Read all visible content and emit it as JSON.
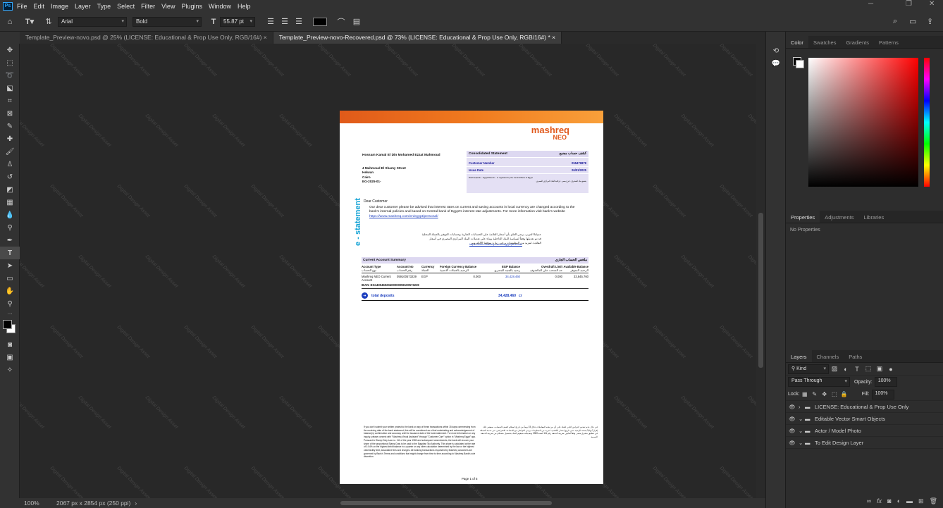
{
  "menubar": {
    "items": [
      "File",
      "Edit",
      "Image",
      "Layer",
      "Type",
      "Select",
      "Filter",
      "View",
      "Plugins",
      "Window",
      "Help"
    ]
  },
  "options": {
    "font_family": "Arial",
    "font_style": "Bold",
    "font_size": "55.87 pt",
    "color": "#000000"
  },
  "tabs": [
    {
      "label": "Template_Preview-novo.psd @ 25% (LICENSE: Educational & Prop Use Only, RGB/16#)",
      "close": "×"
    },
    {
      "label": "Template_Preview-novo-Recovered.psd @ 73% (LICENSE: Educational & Prop Use Only, RGB/16#) *",
      "close": "×"
    }
  ],
  "status": {
    "zoom": "100%",
    "dims": "2067 px x 2854 px (250 ppi)",
    "arrow": "›"
  },
  "color_panel": {
    "tabs": [
      "Color",
      "Swatches",
      "Gradients",
      "Patterns"
    ]
  },
  "properties_panel": {
    "tabs": [
      "Properties",
      "Adjustments",
      "Libraries"
    ],
    "empty": "No Properties"
  },
  "layers_panel": {
    "tabs": [
      "Layers",
      "Channels",
      "Paths"
    ],
    "kind": "Kind",
    "blend": "Pass Through",
    "opacity_label": "Opacity:",
    "opacity": "100%",
    "lock_label": "Lock:",
    "fill_label": "Fill:",
    "fill": "100%",
    "layers": [
      "LICENSE: Educational & Prop Use Only",
      "Editable Vector Smart Objects",
      "Actor / Model Photo",
      "To Edit Design Layer"
    ]
  },
  "watermark": "Digital Design Asset",
  "doc": {
    "logo_line1": "mashreq",
    "logo_line2": "NEO",
    "vertical_text": "e - statement",
    "customer_name": "Hossam Kamal El Din Mohamed Ezzat Mahmoud",
    "address": [
      "4 Mahmoud El Shamy Street",
      "Helwan",
      "Cairo",
      "EG-2025-01-"
    ],
    "box_title": "Consolidated Statement",
    "box_title_ar": "كشف حساب مجمع",
    "cust_no_label": "Customer Number",
    "cust_no": "055479878",
    "issue_label": "Issue Date",
    "issue_date": "26/01/2025",
    "box_note": "Mashreqbank – Egypt Branch – Is regulated by the Central Bank of Egypt",
    "box_note_ar": "يخضع بنك المشرق - فرع مصر - لرقابة البنك المركزي المصري",
    "greeting": "Dear Customer",
    "body_en": "Our dear customer please be advised that interest rates on current and saving accounts in local currency are changed according to the bank's internal policies and based on Central bank of Egypt's interest rate adjustments. For more information visit bank's website",
    "link_en": "https://www.mashreq.com/en/egypt/personal/",
    "body_ar": "عميلنا العزيز، يرجى العلم بأن أسعار الفائدة على الحسابات الجارية وحسابات التوفير بالعملة المحلية قد تم تعديلها وفقاً لسياسة البنك الداخلية وبناء على تعديلات البنك المركزي المصري في أسعار الفائدة. لمزيد من المعلومات يرجى زيارة موقعنا الالكتروني",
    "link_ar": "https://www.mashreq.com/ar/egypt/personal/",
    "summary_title": "Current Account Summary",
    "summary_title_ar": "ملخص الحساب الجاري",
    "columns": [
      "Account Type",
      "Account No",
      "Currency",
      "Foreign Currency Balance",
      "EGP Balance",
      "Overdraft Limit",
      "Available Balance"
    ],
    "columns_ar": [
      "نوع الحساب",
      "رقم الحساب",
      "العملة",
      "الرصيد بالعملات الاجنبية",
      "رصيد بالجنيه المصري",
      "حد السحب على المكشوف",
      "الرصيد المتوفر"
    ],
    "row": [
      "Mashreq NEO Current Account",
      "059100573239",
      "EGP",
      "0.000",
      "34,428.460",
      "0.000",
      "33,845.760"
    ],
    "iban": "IBAN :EG140046020400000059100573239",
    "total_label": "total deposits",
    "total_value": "34,428.460",
    "total_cr": "cr",
    "footer_en": "If you don't submit your written protest to the bank on any of these transactions within 15 days commencing from the receiving date of the bank statement, this will be considered as a final undertaking and acknowledgement of balance(s) confirmation and accuracy until the issuance date of the bank statement. For more information or any inquiry, please connect with \"Mashreq Virtual Assistant\" through \"Customer Care\" option in \"Mashreq Egypt\" app. Pursuant to Stamp Duty Law no. 111 of the year 1980 and subsequent amendments, the bank will recover your share of the proportional Stamp Duty to be paid to the Egyptian Tax Authority. This share is calculated at the rate of 0.04% on the highest debit balance in a quarter or any other calculation determined by the law or the highest valid facility limit, associated fees and charges. All banking transactions requested by Mashreq customers are governed by Bank's Terms and conditions that might change from time to time according to Mashreq Bank's sole discretion.",
    "footer_ar": "في حال عدم تقديم اعتراض كتابي للبنك على أي من هذه المعاملات خلال 15 يوماً من تاريخ استلام كشف الحساب، سيعتبر ذلك إقراراً نهائياً بصحة الرصيد حتى تاريخ إصدار الكشف. لمزيد من المعلومات يرجى التواصل مع المساعد الافتراضي عبر خدمة العملاء في تطبيق مشرق مصر. وفقاً لقانون ضريبة الدمغة رقم 111 لسنة 1980 وتعديلاته سيقوم البنك بتحصيل حصتكم من ضريبة الدمغة النسبية.",
    "page": "Page 1 of 5"
  }
}
